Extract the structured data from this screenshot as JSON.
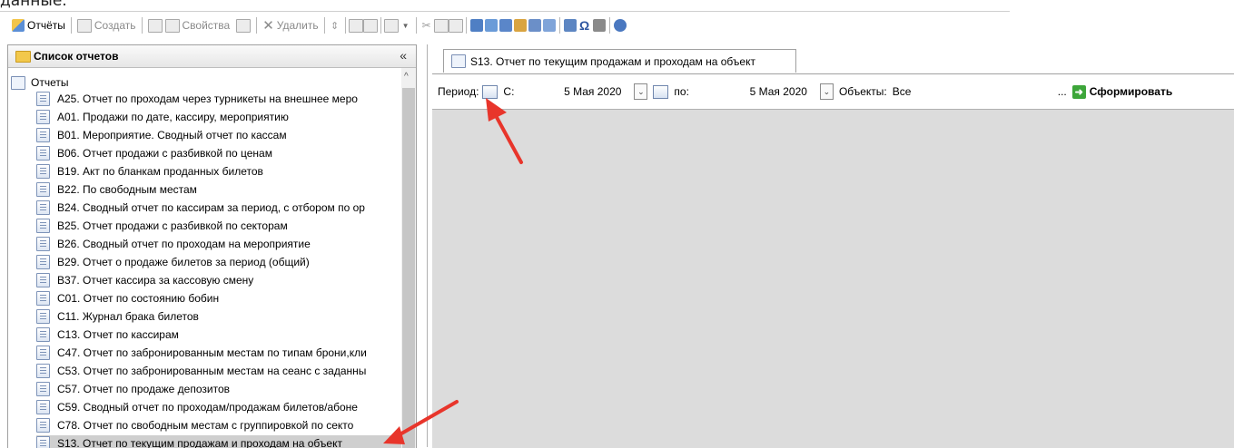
{
  "page_heading_fragment": "данные.",
  "toolbar": {
    "reports_label": "Отчёты",
    "create_label": "Создать",
    "properties_label": "Свойства",
    "delete_label": "Удалить"
  },
  "left_panel": {
    "title": "Список отчетов",
    "collapse_symbol": "«",
    "root_label": "Отчеты",
    "items": [
      {
        "label": "A25. Отчет по проходам через турникеты на внешнее меро"
      },
      {
        "label": "A01. Продажи по дате, кассиру, мероприятию"
      },
      {
        "label": "B01. Мероприятие. Сводный отчет по кассам"
      },
      {
        "label": "B06. Отчет продажи с разбивкой по ценам"
      },
      {
        "label": "B19. Акт по бланкам проданных билетов"
      },
      {
        "label": "B22. По свободным местам"
      },
      {
        "label": "B24. Сводный отчет по кассирам за период, с отбором по ор"
      },
      {
        "label": "B25. Отчет продажи с разбивкой по секторам"
      },
      {
        "label": "B26. Сводный отчет по проходам на мероприятие"
      },
      {
        "label": "B29. Отчет о продаже билетов за период (общий)"
      },
      {
        "label": "B37. Отчет кассира за кассовую смену"
      },
      {
        "label": "C01. Отчет по состоянию бобин"
      },
      {
        "label": "C11. Журнал брака билетов"
      },
      {
        "label": "C13. Отчет по кассирам"
      },
      {
        "label": "C47. Отчет по забронированным местам по типам брони,кли"
      },
      {
        "label": "C53. Отчет по забронированным местам на сеанс с заданны"
      },
      {
        "label": "C57. Отчет по продаже депозитов"
      },
      {
        "label": "C59. Сводный отчет по проходам/продажам билетов/абоне"
      },
      {
        "label": "C78. Отчет по свободным местам с группировкой по секто"
      },
      {
        "label": "S13. Отчет по текущим продажам и проходам на объект"
      }
    ]
  },
  "report_tab": {
    "label": "S13. Отчет по текущим продажам и проходам на объект"
  },
  "filter": {
    "period_label": "Период:",
    "from_label": "С:",
    "from_date": "5 Мая 2020",
    "to_label": "по:",
    "to_date": "5 Мая 2020",
    "objects_label": "Объекты:",
    "objects_value": "Все",
    "browse_label": "...",
    "generate_label": "Сформировать"
  },
  "colors": {
    "annotation_arrow": "#e8352b",
    "selected_row": "#cfcfcf",
    "content_background": "#dcdcdc"
  }
}
